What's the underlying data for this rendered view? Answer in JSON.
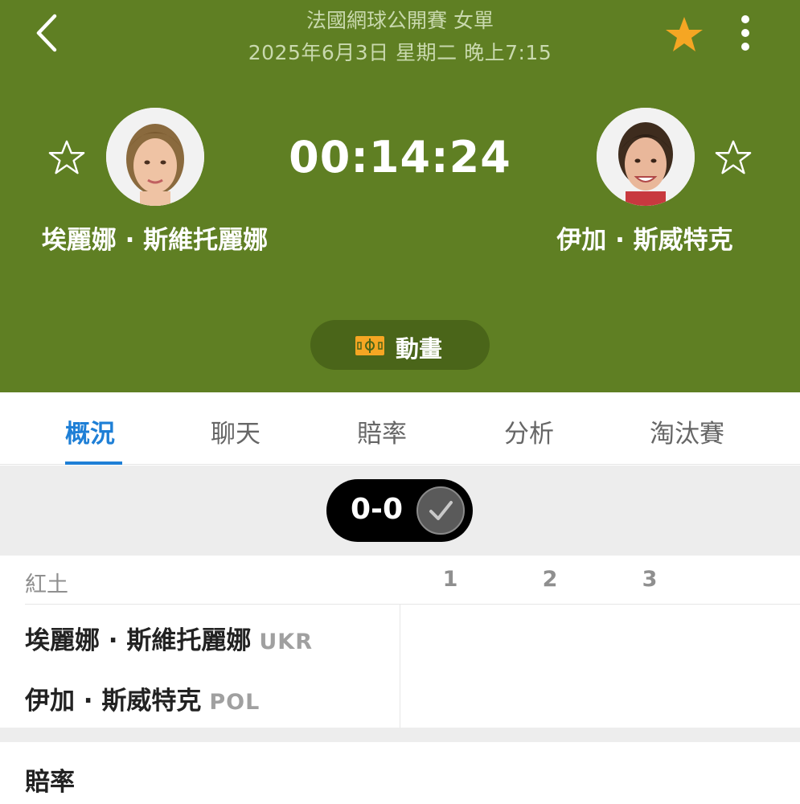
{
  "header": {
    "title": "法國網球公開賽 女單",
    "datetime": "2025年6月3日 星期二 晚上7:15",
    "timer": "00:14:24",
    "animation_label": "動畫",
    "player1": {
      "name": "埃麗娜 · 斯維托麗娜"
    },
    "player2": {
      "name": "伊加 · 斯威特克"
    }
  },
  "tabs": [
    {
      "label": "概況",
      "active": true
    },
    {
      "label": "聊天"
    },
    {
      "label": "賠率"
    },
    {
      "label": "分析"
    },
    {
      "label": "淘汰賽"
    }
  ],
  "score": {
    "text": "0-0"
  },
  "set_table": {
    "surface": "紅土",
    "sets": [
      "1",
      "2",
      "3"
    ],
    "rows": [
      {
        "name": "埃麗娜 · 斯維托麗娜",
        "country": "UKR"
      },
      {
        "name": "伊加 · 斯威特克",
        "country": "POL"
      }
    ]
  },
  "odds": {
    "title": "賠率"
  },
  "colors": {
    "header_bg": "#5f7f23",
    "accent": "#1e7fd6",
    "favorite_star": "#f5a623",
    "animation_icon": "#f5a623"
  },
  "icons": {
    "back": "chevron-left-icon",
    "favorite": "star-filled-icon",
    "more": "more-vertical-icon",
    "player_follow": "star-outline-icon",
    "animation": "pitch-icon",
    "score_confirm": "check-icon"
  }
}
